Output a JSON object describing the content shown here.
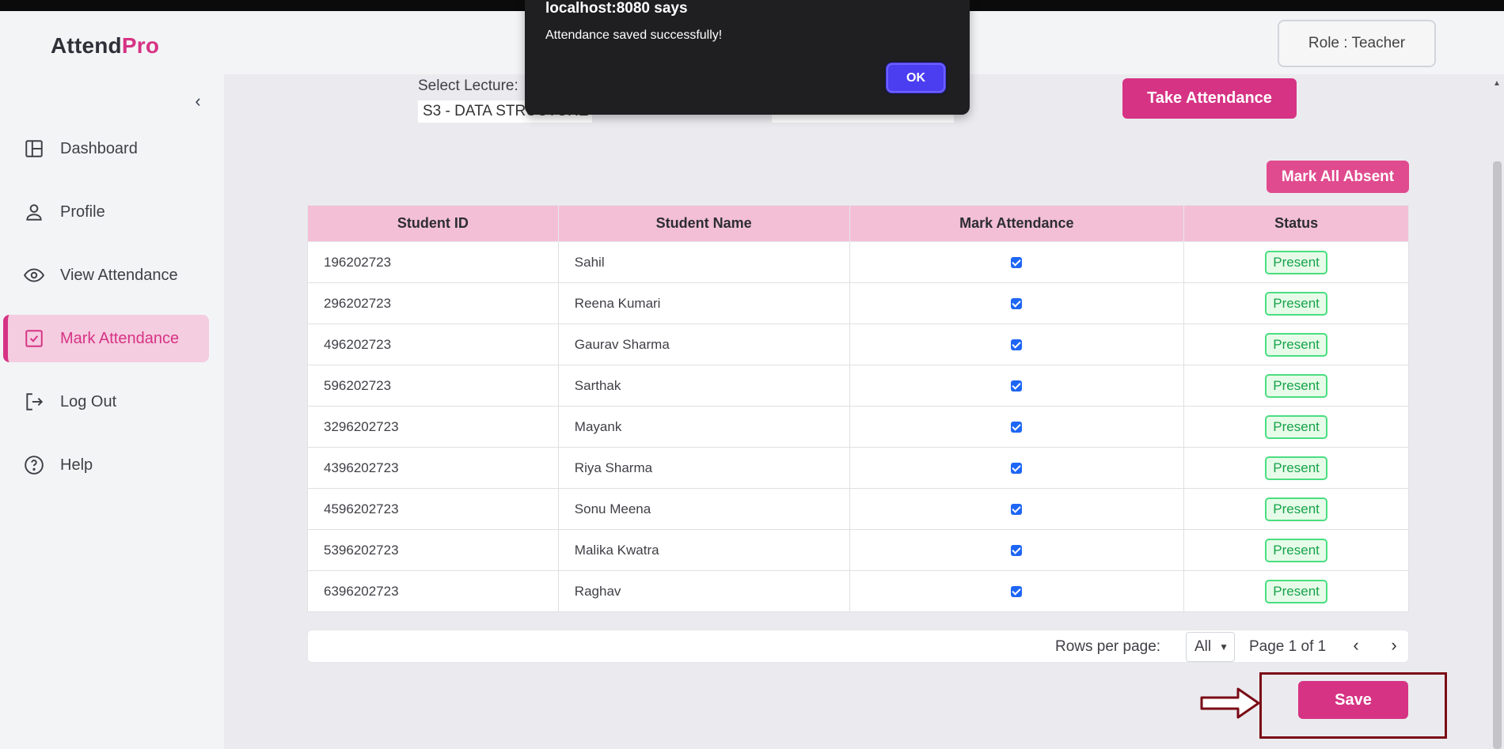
{
  "app": {
    "logo_part1": "Attend",
    "logo_part2": "Pro",
    "brand_color": "#d63384",
    "role_label": "Role : Teacher"
  },
  "sidebar": {
    "items": [
      {
        "label": "Dashboard",
        "icon": "dashboard-icon"
      },
      {
        "label": "Profile",
        "icon": "user-icon"
      },
      {
        "label": "View Attendance",
        "icon": "eye-icon"
      },
      {
        "label": "Mark Attendance",
        "icon": "check-square-icon",
        "active": true
      },
      {
        "label": "Log Out",
        "icon": "logout-icon"
      },
      {
        "label": "Help",
        "icon": "help-icon"
      }
    ]
  },
  "lecture": {
    "label": "Select Lecture:",
    "value": "S3 - DATA STRUCTURE"
  },
  "actions": {
    "take_attendance": "Take Attendance",
    "mark_all_absent": "Mark All Absent",
    "save": "Save"
  },
  "table": {
    "headers": [
      "Student ID",
      "Student Name",
      "Mark Attendance",
      "Status"
    ],
    "rows": [
      {
        "id": "196202723",
        "name": "Sahil",
        "checked": true,
        "status": "Present"
      },
      {
        "id": "296202723",
        "name": "Reena Kumari",
        "checked": true,
        "status": "Present"
      },
      {
        "id": "496202723",
        "name": "Gaurav Sharma",
        "checked": true,
        "status": "Present"
      },
      {
        "id": "596202723",
        "name": "Sarthak",
        "checked": true,
        "status": "Present"
      },
      {
        "id": "3296202723",
        "name": "Mayank",
        "checked": true,
        "status": "Present"
      },
      {
        "id": "4396202723",
        "name": "Riya Sharma",
        "checked": true,
        "status": "Present"
      },
      {
        "id": "4596202723",
        "name": "Sonu Meena",
        "checked": true,
        "status": "Present"
      },
      {
        "id": "5396202723",
        "name": "Malika Kwatra",
        "checked": true,
        "status": "Present"
      },
      {
        "id": "6396202723",
        "name": "Raghav",
        "checked": true,
        "status": "Present"
      }
    ]
  },
  "pagination": {
    "rows_per_page_label": "Rows per page:",
    "rows_per_page_value": "All",
    "page_text": "Page 1 of 1"
  },
  "dialog": {
    "title": "localhost:8080 says",
    "message": "Attendance saved successfully!",
    "ok_label": "OK"
  }
}
